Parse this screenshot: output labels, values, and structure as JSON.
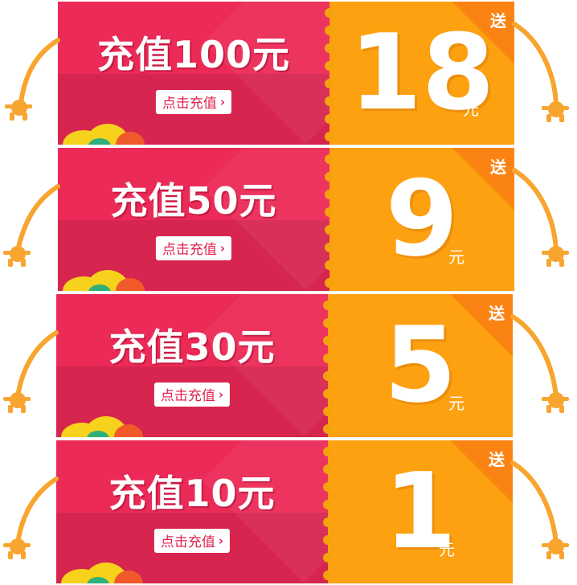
{
  "coupons": [
    {
      "title": "充值100元",
      "button": "点击充值",
      "gift": "送",
      "amount": "18",
      "unit": "元"
    },
    {
      "title": "充值50元",
      "button": "点击充值",
      "gift": "送",
      "amount": "9",
      "unit": "元"
    },
    {
      "title": "充值30元",
      "button": "点击充值",
      "gift": "送",
      "amount": "5",
      "unit": "元"
    },
    {
      "title": "充值10元",
      "button": "点击充值",
      "gift": "送",
      "amount": "1",
      "unit": "元"
    }
  ],
  "colors": {
    "left_panel": "#eb2a57",
    "right_panel": "#fea111",
    "arm": "#f8a530",
    "button_text": "#e0224f"
  },
  "icons": {
    "chevron": "chevron-right-icon",
    "decor": "cloud-hills-decoration"
  }
}
